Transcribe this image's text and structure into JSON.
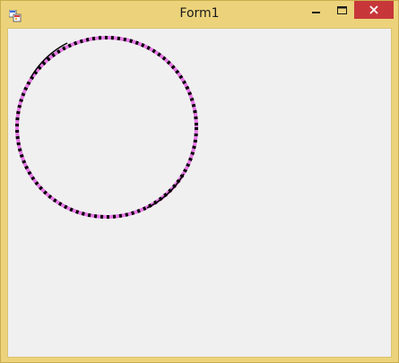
{
  "window": {
    "title": "Form1",
    "controls": {
      "minimize_icon": "minimize-icon",
      "maximize_icon": "maximize-icon",
      "close_icon": "close-icon"
    },
    "colors": {
      "frame": "#ecd37b",
      "close_button": "#c7373a",
      "client_background": "#f0f0f0"
    }
  },
  "canvas": {
    "shapes": [
      {
        "type": "circle",
        "stroke_pattern": "dashed",
        "stroke_colors": [
          "#000000",
          "#e678e6"
        ]
      }
    ]
  }
}
